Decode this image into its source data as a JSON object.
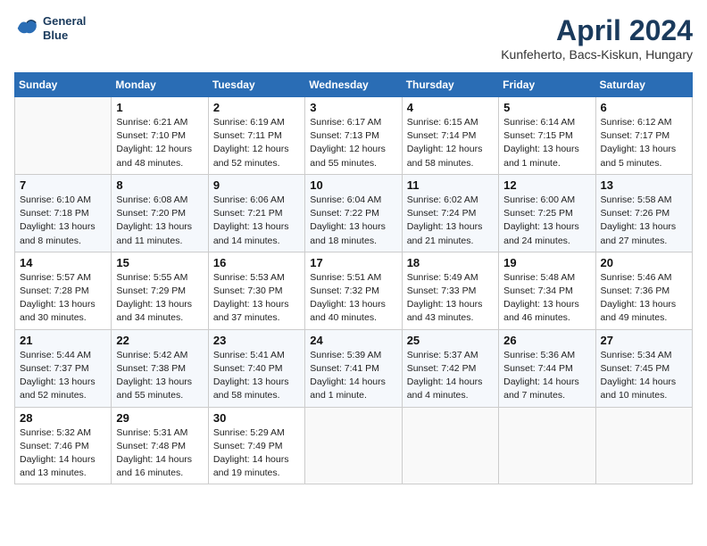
{
  "header": {
    "logo_line1": "General",
    "logo_line2": "Blue",
    "month": "April 2024",
    "location": "Kunfeherto, Bacs-Kiskun, Hungary"
  },
  "days_of_week": [
    "Sunday",
    "Monday",
    "Tuesday",
    "Wednesday",
    "Thursday",
    "Friday",
    "Saturday"
  ],
  "weeks": [
    [
      {
        "date": "",
        "info": ""
      },
      {
        "date": "1",
        "info": "Sunrise: 6:21 AM\nSunset: 7:10 PM\nDaylight: 12 hours\nand 48 minutes."
      },
      {
        "date": "2",
        "info": "Sunrise: 6:19 AM\nSunset: 7:11 PM\nDaylight: 12 hours\nand 52 minutes."
      },
      {
        "date": "3",
        "info": "Sunrise: 6:17 AM\nSunset: 7:13 PM\nDaylight: 12 hours\nand 55 minutes."
      },
      {
        "date": "4",
        "info": "Sunrise: 6:15 AM\nSunset: 7:14 PM\nDaylight: 12 hours\nand 58 minutes."
      },
      {
        "date": "5",
        "info": "Sunrise: 6:14 AM\nSunset: 7:15 PM\nDaylight: 13 hours\nand 1 minute."
      },
      {
        "date": "6",
        "info": "Sunrise: 6:12 AM\nSunset: 7:17 PM\nDaylight: 13 hours\nand 5 minutes."
      }
    ],
    [
      {
        "date": "7",
        "info": "Sunrise: 6:10 AM\nSunset: 7:18 PM\nDaylight: 13 hours\nand 8 minutes."
      },
      {
        "date": "8",
        "info": "Sunrise: 6:08 AM\nSunset: 7:20 PM\nDaylight: 13 hours\nand 11 minutes."
      },
      {
        "date": "9",
        "info": "Sunrise: 6:06 AM\nSunset: 7:21 PM\nDaylight: 13 hours\nand 14 minutes."
      },
      {
        "date": "10",
        "info": "Sunrise: 6:04 AM\nSunset: 7:22 PM\nDaylight: 13 hours\nand 18 minutes."
      },
      {
        "date": "11",
        "info": "Sunrise: 6:02 AM\nSunset: 7:24 PM\nDaylight: 13 hours\nand 21 minutes."
      },
      {
        "date": "12",
        "info": "Sunrise: 6:00 AM\nSunset: 7:25 PM\nDaylight: 13 hours\nand 24 minutes."
      },
      {
        "date": "13",
        "info": "Sunrise: 5:58 AM\nSunset: 7:26 PM\nDaylight: 13 hours\nand 27 minutes."
      }
    ],
    [
      {
        "date": "14",
        "info": "Sunrise: 5:57 AM\nSunset: 7:28 PM\nDaylight: 13 hours\nand 30 minutes."
      },
      {
        "date": "15",
        "info": "Sunrise: 5:55 AM\nSunset: 7:29 PM\nDaylight: 13 hours\nand 34 minutes."
      },
      {
        "date": "16",
        "info": "Sunrise: 5:53 AM\nSunset: 7:30 PM\nDaylight: 13 hours\nand 37 minutes."
      },
      {
        "date": "17",
        "info": "Sunrise: 5:51 AM\nSunset: 7:32 PM\nDaylight: 13 hours\nand 40 minutes."
      },
      {
        "date": "18",
        "info": "Sunrise: 5:49 AM\nSunset: 7:33 PM\nDaylight: 13 hours\nand 43 minutes."
      },
      {
        "date": "19",
        "info": "Sunrise: 5:48 AM\nSunset: 7:34 PM\nDaylight: 13 hours\nand 46 minutes."
      },
      {
        "date": "20",
        "info": "Sunrise: 5:46 AM\nSunset: 7:36 PM\nDaylight: 13 hours\nand 49 minutes."
      }
    ],
    [
      {
        "date": "21",
        "info": "Sunrise: 5:44 AM\nSunset: 7:37 PM\nDaylight: 13 hours\nand 52 minutes."
      },
      {
        "date": "22",
        "info": "Sunrise: 5:42 AM\nSunset: 7:38 PM\nDaylight: 13 hours\nand 55 minutes."
      },
      {
        "date": "23",
        "info": "Sunrise: 5:41 AM\nSunset: 7:40 PM\nDaylight: 13 hours\nand 58 minutes."
      },
      {
        "date": "24",
        "info": "Sunrise: 5:39 AM\nSunset: 7:41 PM\nDaylight: 14 hours\nand 1 minute."
      },
      {
        "date": "25",
        "info": "Sunrise: 5:37 AM\nSunset: 7:42 PM\nDaylight: 14 hours\nand 4 minutes."
      },
      {
        "date": "26",
        "info": "Sunrise: 5:36 AM\nSunset: 7:44 PM\nDaylight: 14 hours\nand 7 minutes."
      },
      {
        "date": "27",
        "info": "Sunrise: 5:34 AM\nSunset: 7:45 PM\nDaylight: 14 hours\nand 10 minutes."
      }
    ],
    [
      {
        "date": "28",
        "info": "Sunrise: 5:32 AM\nSunset: 7:46 PM\nDaylight: 14 hours\nand 13 minutes."
      },
      {
        "date": "29",
        "info": "Sunrise: 5:31 AM\nSunset: 7:48 PM\nDaylight: 14 hours\nand 16 minutes."
      },
      {
        "date": "30",
        "info": "Sunrise: 5:29 AM\nSunset: 7:49 PM\nDaylight: 14 hours\nand 19 minutes."
      },
      {
        "date": "",
        "info": ""
      },
      {
        "date": "",
        "info": ""
      },
      {
        "date": "",
        "info": ""
      },
      {
        "date": "",
        "info": ""
      }
    ]
  ]
}
